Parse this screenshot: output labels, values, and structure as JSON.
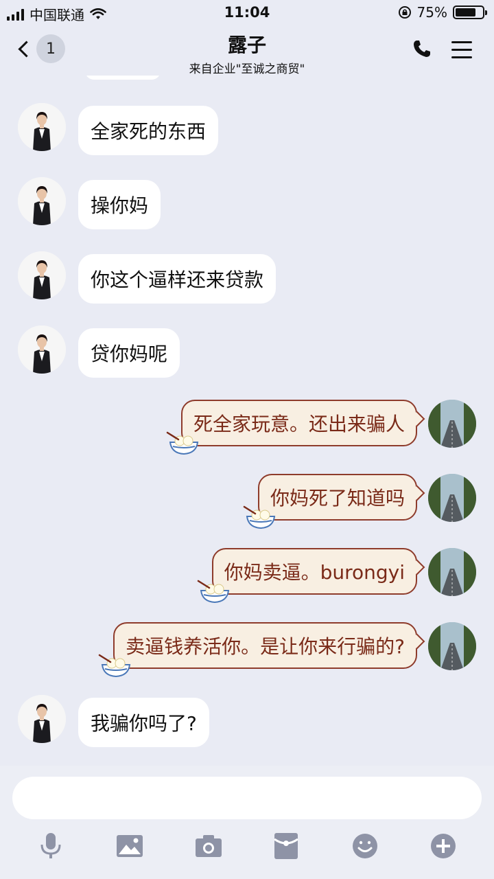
{
  "status_bar": {
    "carrier": "中国联通",
    "time": "11:04",
    "battery": "75%",
    "battery_level": 0.75
  },
  "nav": {
    "back_badge": "1",
    "title": "露子",
    "subtitle": "来自企业\"至诚之商贸\""
  },
  "messages": [
    {
      "side": "in",
      "text": "全家死的东西"
    },
    {
      "side": "in",
      "text": "操你妈"
    },
    {
      "side": "in",
      "text": "你这个逼样还来贷款"
    },
    {
      "side": "in",
      "text": "贷你妈呢"
    },
    {
      "side": "out",
      "text": "死全家玩意。还出来骗人"
    },
    {
      "side": "out",
      "text": "你妈死了知道吗"
    },
    {
      "side": "out",
      "text": "你妈卖逼。burongyi"
    },
    {
      "side": "out",
      "text": "卖逼钱养活你。是让你来行骗的?"
    },
    {
      "side": "in",
      "text": "我骗你吗了?"
    }
  ],
  "input": {
    "value": "",
    "placeholder": ""
  },
  "toolbar_icons": [
    "microphone-icon",
    "image-icon",
    "camera-icon",
    "red-packet-icon",
    "emoji-icon",
    "plus-icon"
  ],
  "colors": {
    "background": "#e9ebf4",
    "incoming_bubble": "#ffffff",
    "outgoing_bubble": "#f8efe2",
    "outgoing_border": "#8e3b2b",
    "outgoing_text": "#7a2a18",
    "icon_gray": "#8e93a6"
  }
}
